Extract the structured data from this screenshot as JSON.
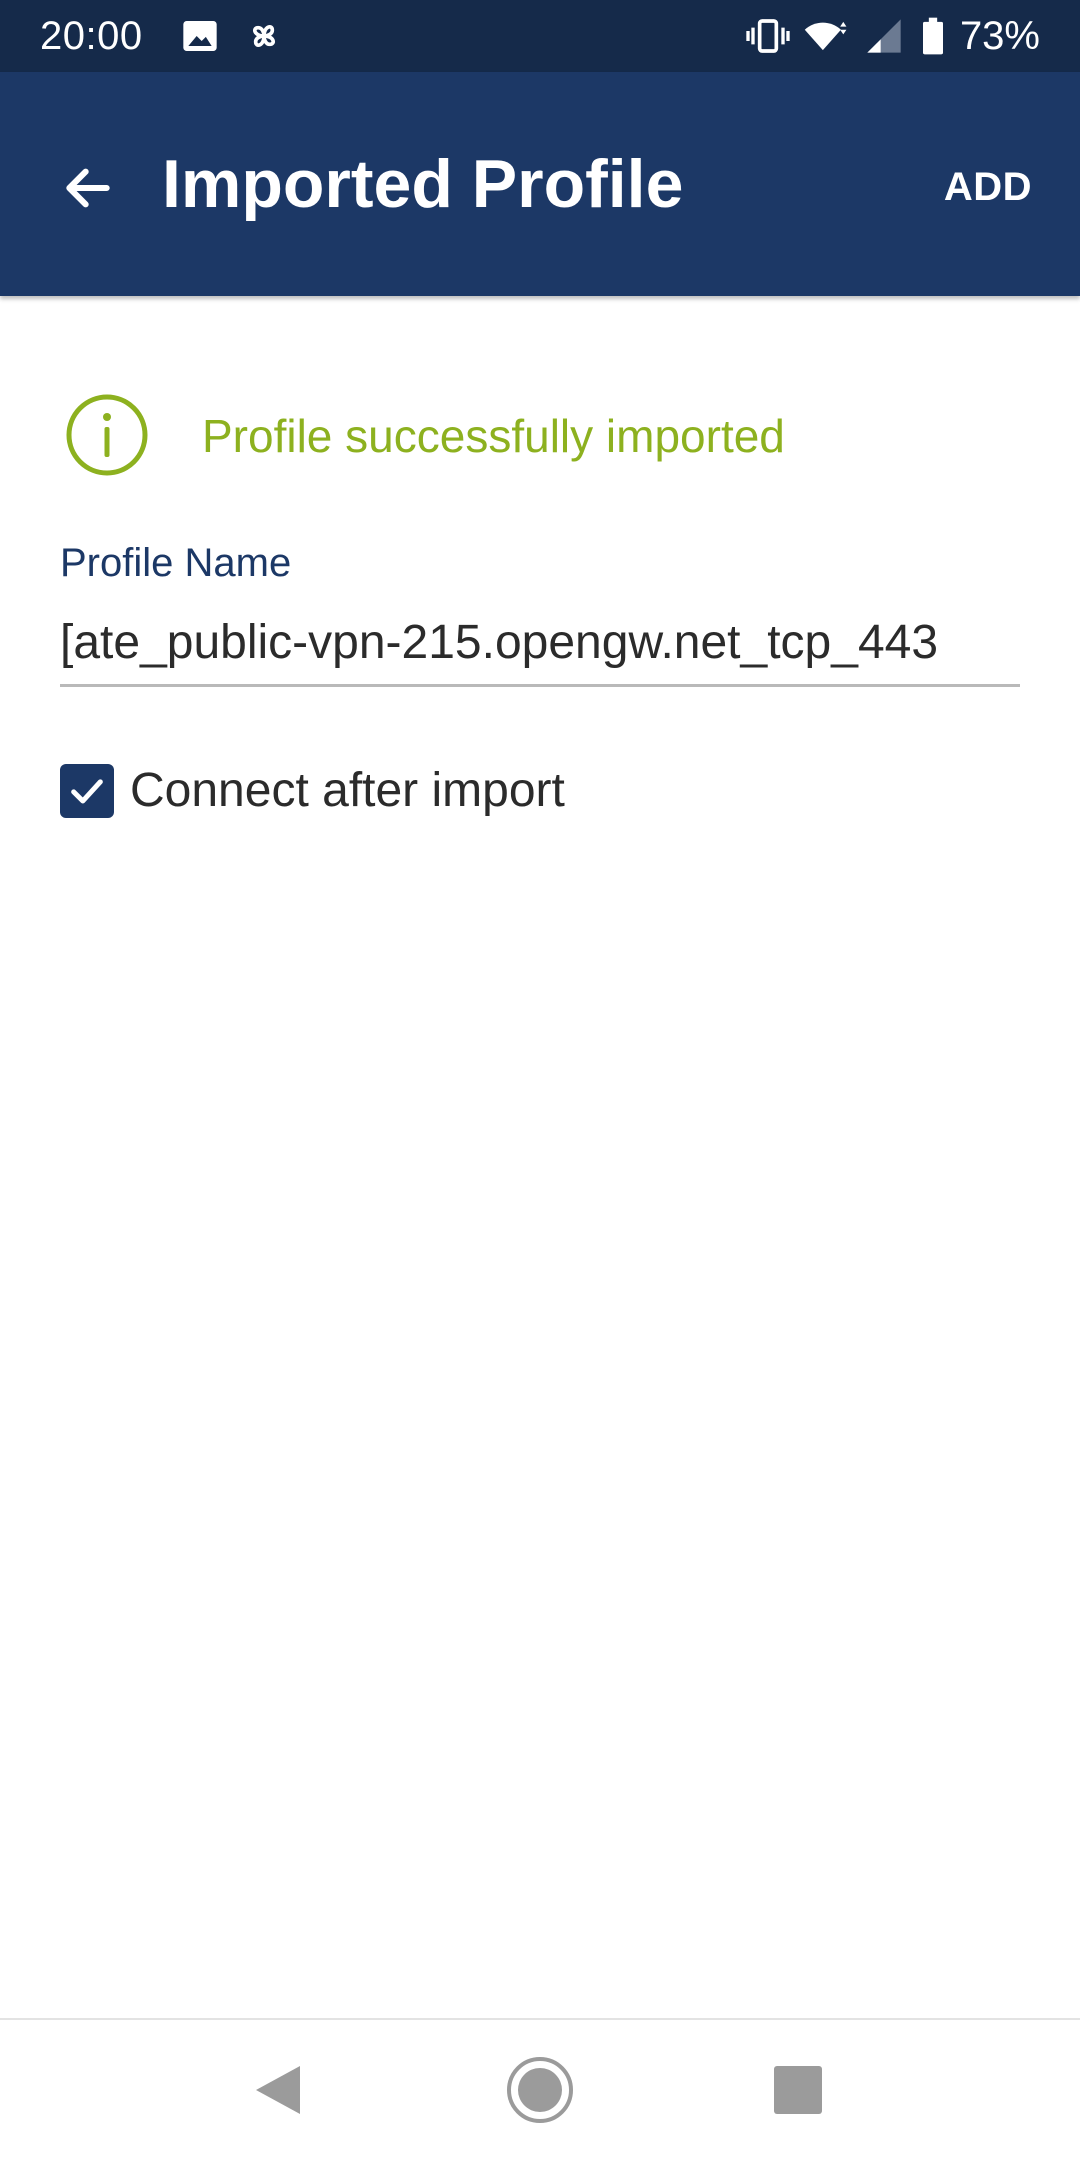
{
  "status_bar": {
    "time": "20:00",
    "battery": "73%",
    "left_icons": [
      "image-icon",
      "pinwheel-icon"
    ],
    "right_icons": [
      "vibrate-icon",
      "wifi-icon",
      "signal-icon",
      "battery-icon"
    ]
  },
  "app_bar": {
    "title": "Imported Profile",
    "back_icon": "arrow-left-icon",
    "action_label": "ADD",
    "color": "#1c3866"
  },
  "notice": {
    "icon": "info-icon",
    "text": "Profile successfully imported",
    "color": "#8db11f"
  },
  "profile_name": {
    "label": "Profile Name",
    "value": "ate_public-vpn-215.opengw.net_tcp_443]"
  },
  "connect_after_import": {
    "label": "Connect after import",
    "checked": true
  },
  "nav_bar": {
    "icons": [
      "nav-back-icon",
      "nav-home-icon",
      "nav-recents-icon"
    ]
  }
}
